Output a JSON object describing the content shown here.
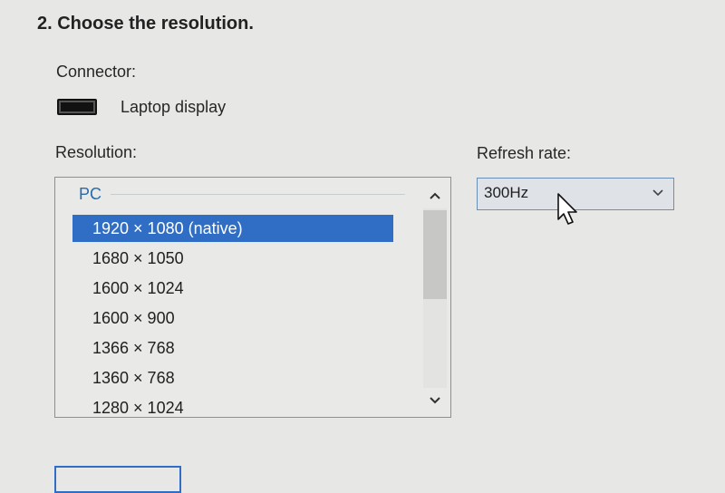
{
  "step": {
    "title": "2. Choose the resolution."
  },
  "connector": {
    "label": "Connector:",
    "value": "Laptop display",
    "icon": "display-connector-icon"
  },
  "resolution": {
    "label": "Resolution:",
    "group": "PC",
    "items": [
      {
        "label": "1920 × 1080 (native)",
        "selected": true
      },
      {
        "label": "1680 × 1050",
        "selected": false
      },
      {
        "label": "1600 × 1024",
        "selected": false
      },
      {
        "label": "1600 × 900",
        "selected": false
      },
      {
        "label": "1366 × 768",
        "selected": false
      },
      {
        "label": "1360 × 768",
        "selected": false
      },
      {
        "label": "1280 × 1024",
        "selected": false
      }
    ]
  },
  "refresh_rate": {
    "label": "Refresh rate:",
    "value": "300Hz"
  },
  "colors": {
    "selection": "#2f6ec4",
    "group_label": "#2a6aa8",
    "background": "#e7e8e6"
  }
}
